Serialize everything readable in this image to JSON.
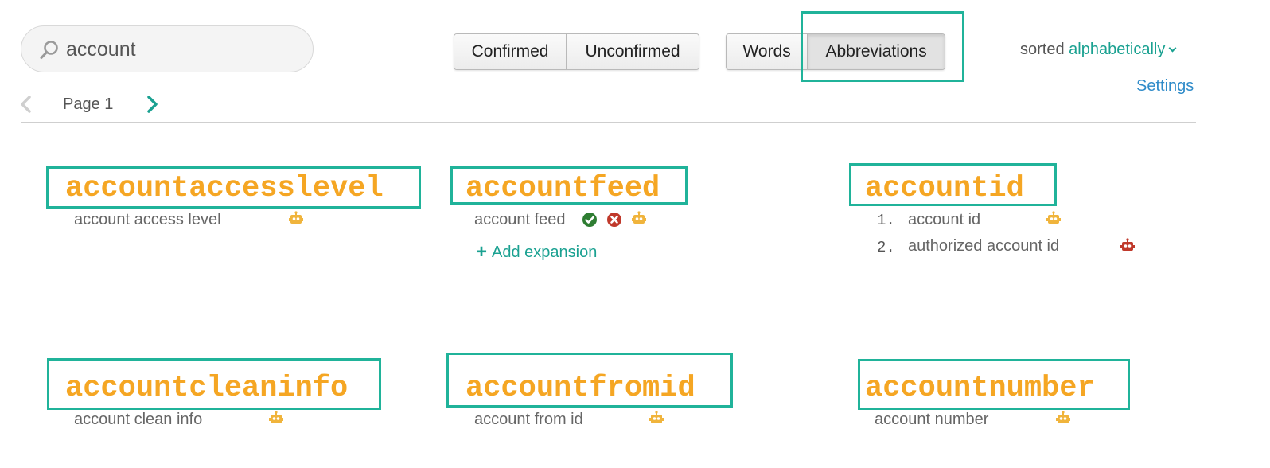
{
  "search": {
    "value": "account",
    "icon": "search-icon"
  },
  "filters": {
    "status": [
      "Confirmed",
      "Unconfirmed"
    ],
    "type": [
      "Words",
      "Abbreviations"
    ],
    "active_type": "Abbreviations"
  },
  "sort": {
    "prefix": "sorted",
    "value": "alphabetically"
  },
  "settings_label": "Settings",
  "pager": {
    "label": "Page 1"
  },
  "colors": {
    "accent": "#1aa191",
    "highlight_border": "#20b39a",
    "abbreviation": "#f5a623",
    "robot_yellow": "#f0b43c",
    "robot_red": "#c0392b",
    "confirm": "#2e7d32",
    "reject": "#c0392b"
  },
  "cards": [
    {
      "abbr": "accountaccesslevel",
      "expansions": [
        {
          "text": "account access level",
          "icon": "robot-icon"
        }
      ]
    },
    {
      "abbr": "accountfeed",
      "expansions": [
        {
          "text": "account feed",
          "icon": "robot-icon"
        }
      ],
      "add_label": "Add expansion"
    },
    {
      "abbr": "accountid",
      "expansions": [
        {
          "num": "1.",
          "text": "account id",
          "icon": "robot-icon"
        },
        {
          "num": "2.",
          "text": "authorized account id",
          "icon": "robot-icon"
        }
      ]
    },
    {
      "abbr": "accountcleaninfo",
      "expansions": [
        {
          "text": "account clean info",
          "icon": "robot-icon"
        }
      ]
    },
    {
      "abbr": "accountfromid",
      "expansions": [
        {
          "text": "account from id",
          "icon": "robot-icon"
        }
      ]
    },
    {
      "abbr": "accountnumber",
      "expansions": [
        {
          "text": "account number",
          "icon": "robot-icon"
        }
      ]
    }
  ]
}
